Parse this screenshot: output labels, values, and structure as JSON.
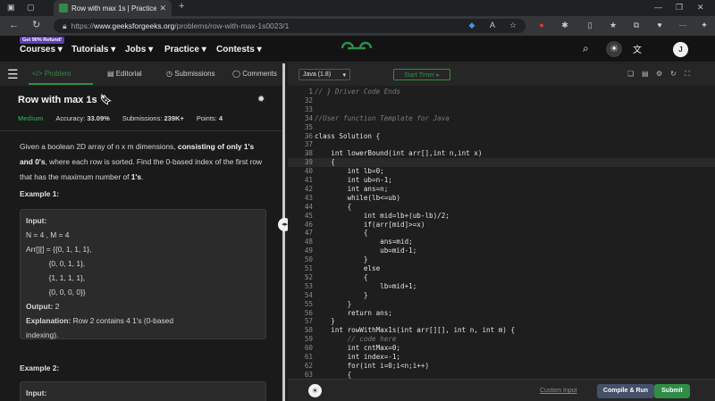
{
  "browser": {
    "tab_title": "Row with max 1s | Practice | Geel",
    "url_prefix": "https://",
    "url_host": "www.geeksforgeeks.org",
    "url_path": "/problems/row-with-max-1s0023/1"
  },
  "nav": {
    "promo": "Get 90% Refund!",
    "items": [
      "Courses",
      "Tutorials",
      "Jobs",
      "Practice",
      "Contests"
    ],
    "avatar_initial": "J"
  },
  "left": {
    "tabs": [
      "Problem",
      "Editorial",
      "Submissions",
      "Comments"
    ],
    "title": "Row with max 1s",
    "difficulty": "Medium",
    "accuracy_label": "Accuracy:",
    "accuracy": "33.09%",
    "submissions_label": "Submissions:",
    "submissions": "239K+",
    "points_label": "Points:",
    "points": "4",
    "desc_1": "Given a boolean 2D array of n x m dimensions, ",
    "desc_bold_1": "consisting of only 1's",
    "desc_bold_2": "and 0's",
    "desc_2": ", where each row is sorted. Find the 0-based index of the first row that has the maximum number of ",
    "desc_bold_3": "1's",
    "desc_3": ".",
    "example1_head": "Example 1:",
    "example1": {
      "input_label": "Input:",
      "line1": "N = 4 , M = 4",
      "line2": "Arr[][] = {{0, 1, 1, 1},",
      "line3": "           {0, 0, 1, 1},",
      "line4": "           {1, 1, 1, 1},",
      "line5": "           {0, 0, 0, 0}}",
      "output_label": "Output:",
      "output": "2",
      "explanation_label": "Explanation:",
      "explanation_1": "Row 2 contains 4 1's (0-based",
      "explanation_2": "indexing)."
    },
    "example2_head": "Example 2:",
    "example2_input_label": "Input:"
  },
  "editor": {
    "language": "Java (1.8)",
    "timer": "Start Timer",
    "custom_input": "Custom Input",
    "compile": "Compile & Run",
    "submit": "Submit",
    "lines": [
      {
        "n": "1",
        "t": "// } Driver Code Ends",
        "c": "cmt"
      },
      {
        "n": "32",
        "t": ""
      },
      {
        "n": "33",
        "t": ""
      },
      {
        "n": "34",
        "t": "//User function Template for Java",
        "c": "cmt"
      },
      {
        "n": "35",
        "t": ""
      },
      {
        "n": "36",
        "t": "class Solution {"
      },
      {
        "n": "37",
        "t": ""
      },
      {
        "n": "38",
        "t": "    int lowerBound(int arr[],int n,int x)"
      },
      {
        "n": "39",
        "t": "    {",
        "cur": true
      },
      {
        "n": "40",
        "t": "        int lb=0;"
      },
      {
        "n": "41",
        "t": "        int ub=n-1;"
      },
      {
        "n": "42",
        "t": "        int ans=n;"
      },
      {
        "n": "43",
        "t": "        while(lb<=ub)"
      },
      {
        "n": "44",
        "t": "        {"
      },
      {
        "n": "45",
        "t": "            int mid=lb+(ub-lb)/2;"
      },
      {
        "n": "46",
        "t": "            if(arr[mid]>=x)"
      },
      {
        "n": "47",
        "t": "            {"
      },
      {
        "n": "48",
        "t": "                ans=mid;"
      },
      {
        "n": "49",
        "t": "                ub=mid-1;"
      },
      {
        "n": "50",
        "t": "            }"
      },
      {
        "n": "51",
        "t": "            else"
      },
      {
        "n": "52",
        "t": "            {"
      },
      {
        "n": "53",
        "t": "                lb=mid+1;"
      },
      {
        "n": "54",
        "t": "            }"
      },
      {
        "n": "55",
        "t": "        }"
      },
      {
        "n": "56",
        "t": "        return ans;"
      },
      {
        "n": "57",
        "t": "    }"
      },
      {
        "n": "58",
        "t": "    int rowWithMax1s(int arr[][], int n, int m) {"
      },
      {
        "n": "59",
        "t": "        // code here",
        "c": "cmt"
      },
      {
        "n": "60",
        "t": "        int cntMax=0;"
      },
      {
        "n": "61",
        "t": "        int index=-1;"
      },
      {
        "n": "62",
        "t": "        for(int i=0;i<n;i++)"
      },
      {
        "n": "63",
        "t": "        {"
      }
    ]
  }
}
